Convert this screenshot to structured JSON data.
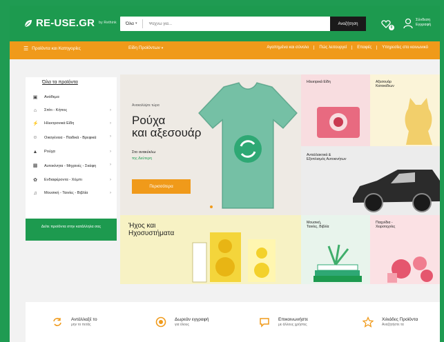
{
  "colors": {
    "brand_green": "#1d9a4f",
    "accent_orange": "#f09a1a",
    "dark": "#1a1a1a"
  },
  "header": {
    "logo": "RE-USE.GR",
    "logo_sub": "by Rethink",
    "search": {
      "category": "Όλα",
      "placeholder": "Ψάχνω για...",
      "button": "Αναζήτηση"
    },
    "wishlist_count": "0",
    "account_line1": "Σύνδεση",
    "account_line2": "Εγγραφή"
  },
  "nav": {
    "all_categories": "Προϊόντα και Κατηγορίες",
    "categories_menu": "Είδη Προϊόντων",
    "links": [
      "Αγαπημένα και σύνολο",
      "Πώς λειτουργεί",
      "Επαφές",
      "Υπηρεσίες στο κοινωνικό"
    ]
  },
  "sidebar": {
    "heading": "Όλα τα προϊόντα",
    "items": [
      {
        "label": "Ανάθεμα",
        "icon": "shirt-icon"
      },
      {
        "label": "Σπίτι - Κήπος",
        "icon": "home-icon"
      },
      {
        "label": "Ηλεκτρονικά Είδη",
        "icon": "plug-icon"
      },
      {
        "label": "Οικογένεια - Παιδικά - Βρεφικά",
        "icon": "baby-icon"
      },
      {
        "label": "Ρούχα",
        "icon": "tshirt-icon"
      },
      {
        "label": "Αυτοκίνητα - Μηχανές - Σκάφη",
        "icon": "car-icon"
      },
      {
        "label": "Ενδιαφέροντα - Χόμπι",
        "icon": "hobby-icon"
      },
      {
        "label": "Μουσική - Ταινίες - Βιβλία",
        "icon": "music-icon"
      }
    ],
    "footer": "Δείτε προϊόντα στην κατάλληλα σας"
  },
  "hero": {
    "small": "Ανακαλύψτε τώρα",
    "title_line1": "Ρούχα",
    "title_line2": "και αξεσουάρ",
    "desc_line1": "Στο ανακύκλω",
    "desc_line2": "της Δεύτερη",
    "cta": "Περισσότερα"
  },
  "sound_banner": {
    "title_line1": "Ήχος και",
    "title_line2": "Ηχοσυστήματα"
  },
  "tiles": {
    "electronics": "Ηλεκτρικά Είδη",
    "pets": "Αξεσουάρ Κατοικίδιων",
    "cars": "Ανταλλακτικά & Εξοπλισμός Αυτοκινήτων",
    "books": "Μουσική, Ταινίες, Βιβλία",
    "toys": "Παιχνίδια - Χειροτεχνίες"
  },
  "features": [
    {
      "title": "Αντάλλαξέ το",
      "sub": "μην το πετάς",
      "icon": "recycle-icon"
    },
    {
      "title": "Δωρεάν εγγραφή",
      "sub": "για όλους",
      "icon": "coin-icon"
    },
    {
      "title": "Επικοινωνήστε",
      "sub": "με άλλους χρήστες",
      "icon": "chat-icon"
    },
    {
      "title": "Χιλιάδες Προϊόντα",
      "sub": "Αναζητήστε τα",
      "icon": "star-icon"
    }
  ]
}
